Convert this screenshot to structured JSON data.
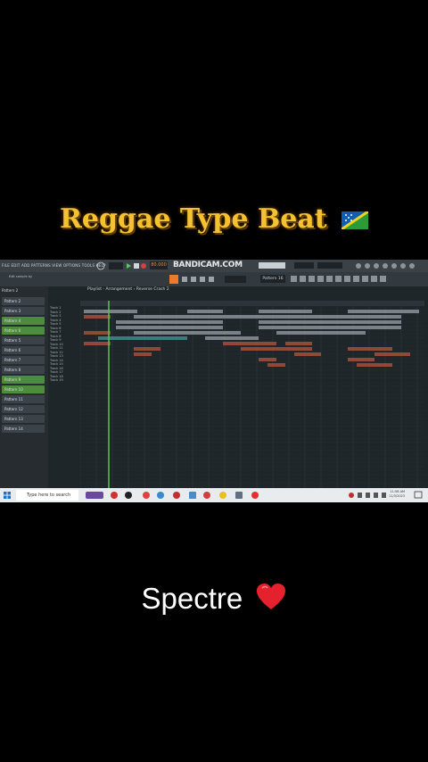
{
  "overlay": {
    "title": "Reggae Type Beat",
    "caption": "Spectre"
  },
  "fl_studio": {
    "menus": "FILE EDIT ADD PATTERNS VIEW OPTIONS TOOLS HELP",
    "bpm": "80.000",
    "recorder_watermark": "BANDICAM.COM",
    "hint": "Edit sample by",
    "pattern_selector": "Pattern 16",
    "playlist_title": "Playlist - Arrangement › Reverse Crash 2",
    "channel_rack_title": "Pattern 2",
    "patterns": [
      {
        "label": "Pattern 2",
        "active": false
      },
      {
        "label": "Pattern 3",
        "active": false
      },
      {
        "label": "Pattern 4",
        "active": true
      },
      {
        "label": "Pattern 6",
        "active": true
      },
      {
        "label": "Pattern 5",
        "active": false
      },
      {
        "label": "Pattern 6",
        "active": false
      },
      {
        "label": "Pattern 7",
        "active": false
      },
      {
        "label": "Pattern 8",
        "active": false
      },
      {
        "label": "Pattern 9",
        "active": true
      },
      {
        "label": "Pattern 10",
        "active": true
      },
      {
        "label": "Pattern 11",
        "active": false
      },
      {
        "label": "Pattern 12",
        "active": false
      },
      {
        "label": "Pattern 13",
        "active": false
      },
      {
        "label": "Pattern 14",
        "active": false
      }
    ],
    "tracks": [
      "Track 1",
      "Track 2",
      "Track 3",
      "Track 4",
      "Track 5",
      "Track 6",
      "Track 7",
      "Track 8",
      "Track 9",
      "Track 10",
      "Track 11",
      "Track 12",
      "Track 13",
      "Track 14",
      "Track 15",
      "Track 16",
      "Track 17",
      "Track 18",
      "Track 19"
    ]
  },
  "taskbar": {
    "search_placeholder": "Type here to search",
    "time": "11:58 AM",
    "date": "11/3/2023"
  },
  "colors": {
    "title": "#f4c230",
    "pattern_active": "#4c8c3c",
    "pattern_idle": "#3b4349",
    "clip_gray": "#8a9398",
    "clip_red": "#a5503a",
    "clip_teal": "#3d8c8c",
    "playhead": "#58c845"
  }
}
